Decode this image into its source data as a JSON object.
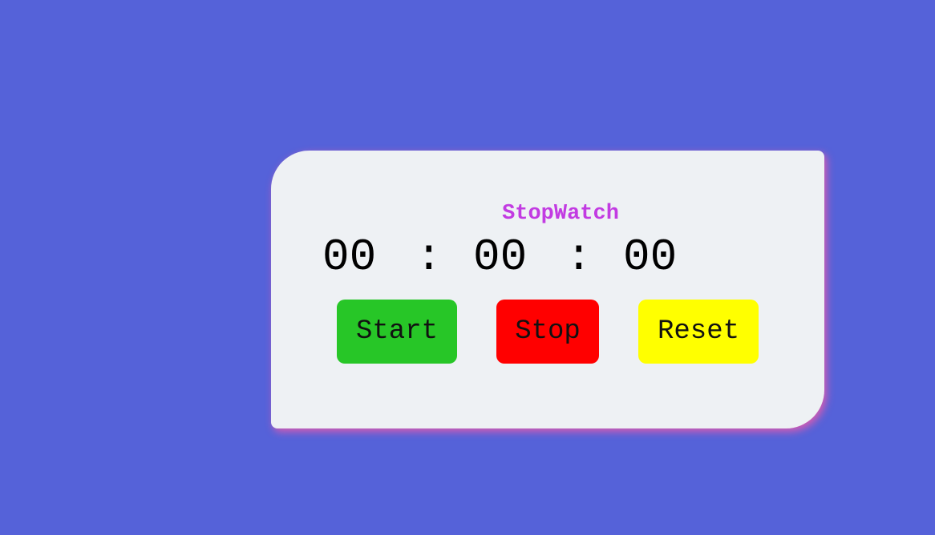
{
  "stopwatch": {
    "title": "StopWatch",
    "hours": "00",
    "separator1": ":",
    "minutes": "00",
    "separator2": ":",
    "seconds": "00"
  },
  "buttons": {
    "start_label": "Start",
    "stop_label": "Stop",
    "reset_label": "Reset"
  },
  "colors": {
    "background": "#5562d9",
    "card": "#eef1f4",
    "title": "#c23be2",
    "start": "#27c627",
    "stop": "#ff0000",
    "reset": "#ffff00"
  }
}
